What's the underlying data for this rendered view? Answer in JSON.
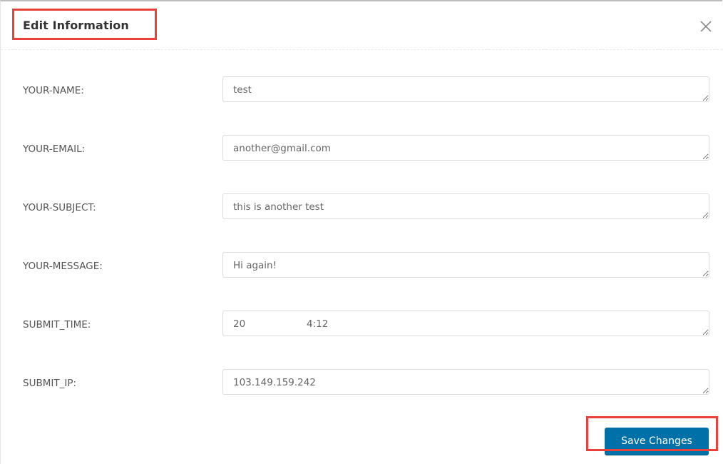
{
  "modal": {
    "title": "Edit Information",
    "close_icon": "close-x-icon",
    "fields": [
      {
        "label": "YOUR-NAME:",
        "value": "test"
      },
      {
        "label": "YOUR-EMAIL:",
        "value": "another@gmail.com"
      },
      {
        "label": "YOUR-SUBJECT:",
        "value": "this is another test"
      },
      {
        "label": "YOUR-MESSAGE:",
        "value": "Hi again!"
      },
      {
        "label": "SUBMIT_TIME:",
        "value": "20                    4:12"
      },
      {
        "label": "SUBMIT_IP:",
        "value": "103.149.159.242"
      }
    ],
    "save_label": "Save Changes"
  },
  "colors": {
    "accent": "#0071a8",
    "highlight": "#e8413b"
  }
}
